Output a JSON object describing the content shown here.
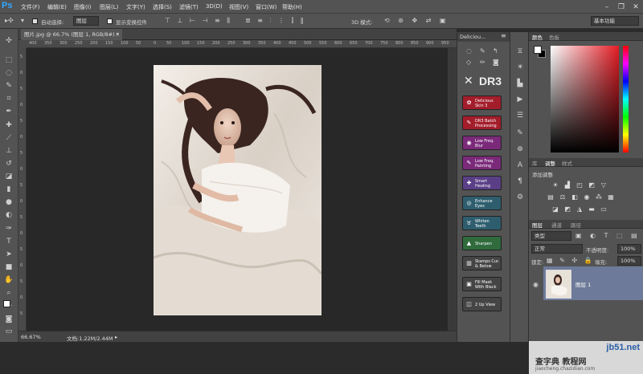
{
  "app": {
    "logo": "Ps"
  },
  "menu": [
    "文件(F)",
    "编辑(E)",
    "图像(I)",
    "图层(L)",
    "文字(Y)",
    "选择(S)",
    "滤镜(T)",
    "3D(D)",
    "视图(V)",
    "窗口(W)",
    "帮助(H)"
  ],
  "options": {
    "auto_select_label": "自动选择:",
    "auto_select_value": "图层",
    "show_transform_label": "显示变换控件",
    "mode_3d_label": "3D 模式:",
    "workspace": "基本功能"
  },
  "document": {
    "tab_title": "图片.jpg @ 66.7% (图层 1, RGB/8#) *",
    "tab_close": "×"
  },
  "ruler_h": [
    "400",
    "350",
    "300",
    "250",
    "200",
    "150",
    "100",
    "50",
    "0",
    "50",
    "100",
    "150",
    "200",
    "250",
    "300",
    "350",
    "400",
    "450",
    "500",
    "550",
    "600",
    "650",
    "700",
    "750",
    "800",
    "850",
    "900",
    "950"
  ],
  "ruler_v": [
    "5",
    "0",
    "5",
    "0",
    "5",
    "0",
    "5",
    "0",
    "5",
    "0",
    "5",
    "0",
    "5",
    "0",
    "5",
    "0",
    "5"
  ],
  "status": {
    "zoom": "66.67%",
    "doc": "文档:1.22M/2.44M"
  },
  "plugin": {
    "title": "Deliciou...",
    "brand": "DR3",
    "buttons": [
      {
        "label": "Delicious Skin 3",
        "color": "#a31d2b",
        "icon": "skin-icon"
      },
      {
        "label": "DR3 Batch Processing",
        "color": "#a31d2b",
        "icon": "batch-icon"
      },
      {
        "label": "Low Freq. Blur",
        "color": "#7b2a7a",
        "icon": "blur-icon"
      },
      {
        "label": "Low Freq. Painting",
        "color": "#7b2a7a",
        "icon": "brush-icon"
      },
      {
        "label": "Smart Healing",
        "color": "#5a3f87",
        "icon": "bandage-icon"
      },
      {
        "label": "Enhance Eyes",
        "color": "#2e5e6e",
        "icon": "eye-icon"
      },
      {
        "label": "Whiten Teeth",
        "color": "#2e5e6e",
        "icon": "tooth-icon"
      },
      {
        "label": "Sharpen",
        "color": "#2f6b3d",
        "icon": "triangle-icon"
      },
      {
        "label": "Stamps Cur. & Below",
        "color": "#454545",
        "icon": "stamp-icon"
      },
      {
        "label": "Fill Mask With Black",
        "color": "#454545",
        "icon": "mask-icon"
      },
      {
        "label": "2 Up View",
        "color": "#454545",
        "icon": "view-icon"
      }
    ]
  },
  "color_panel": {
    "tabs": [
      "颜色",
      "色板"
    ],
    "fg": "#ffffff",
    "bg": "#000000"
  },
  "adjust_panel": {
    "tabs": [
      "库",
      "调整",
      "样式"
    ],
    "title": "添加调整"
  },
  "layers_panel": {
    "tabs": [
      "图层",
      "通道",
      "路径"
    ],
    "filter": "类型",
    "blend": "正常",
    "opacity_label": "不透明度:",
    "opacity": "100%",
    "lock_label": "锁定:",
    "fill_label": "填充:",
    "fill": "100%",
    "layer_name": "图层 1"
  },
  "watermark": {
    "line1": "jb51.net",
    "line2": "查字典 教程网",
    "line3": "jiaocheng.chazidian.com"
  }
}
